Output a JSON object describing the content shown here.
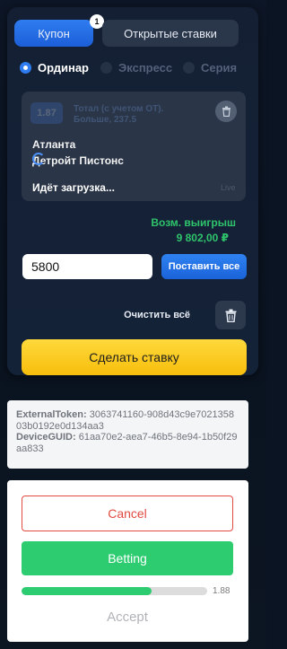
{
  "tabs": {
    "coupon": "Купон",
    "coupon_badge": "1",
    "open_bets": "Открытые ставки"
  },
  "bet_types": {
    "single": "Ординар",
    "express": "Экспресс",
    "series": "Серия",
    "selected": "Ординар"
  },
  "bet_card": {
    "odds": "1.87",
    "market": "Тотал (с учетом ОТ). Больше, 237.5",
    "team1": "Атланта",
    "team2": "Детройт Пистонс",
    "loading_text": "Идёт загрузка...",
    "live_label": "Live"
  },
  "winnings": {
    "label": "Возм. выигрыш",
    "value": "9 802,00 ₽"
  },
  "stake": {
    "value": "5800",
    "stake_all_label": "Поставить все"
  },
  "clear_all": "Очистить всё",
  "place_bet": "Сделать ставку",
  "token_panel": {
    "external_token_label": "ExternalToken:",
    "external_token_value": "3063741160-908d43c9e702135803b0192e0d134aa3",
    "device_guid_label": "DeviceGUID:",
    "device_guid_value": "61aa70e2-aea7-46b5-8e94-1b50f29aa833"
  },
  "actions": {
    "cancel": "Cancel",
    "betting": "Betting",
    "progress_fraction": 0.7,
    "progress_value": "1.88",
    "accept": "Accept"
  },
  "colors": {
    "accent_blue": "#2f7cf0",
    "win_green": "#2fc46c",
    "place_bet_yellow": "#f7be0c",
    "cancel_red": "#e14b42",
    "betting_green": "#2ecc71"
  }
}
